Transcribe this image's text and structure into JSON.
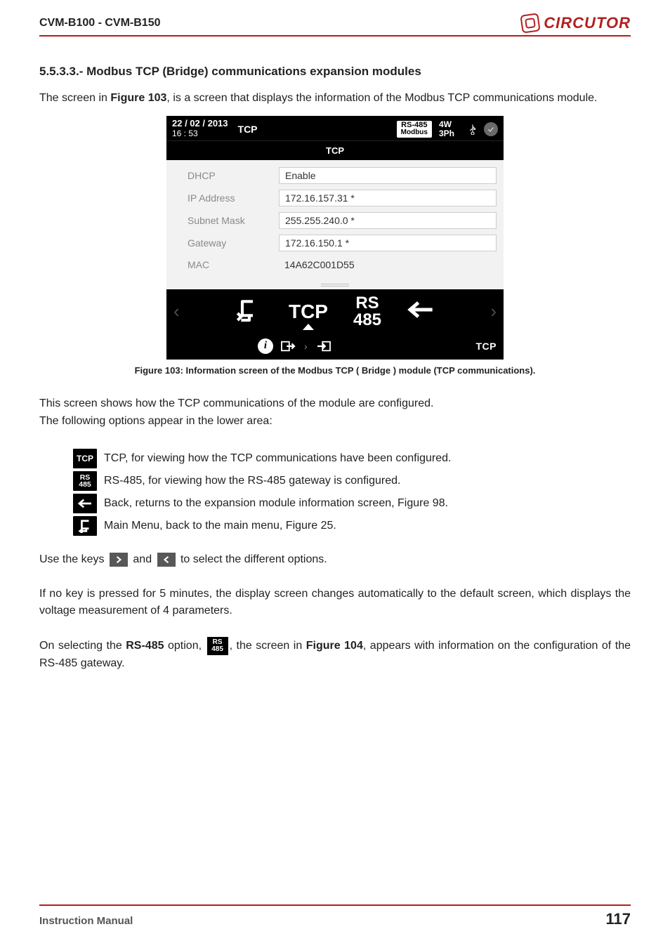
{
  "header": {
    "model": "CVM-B100 - CVM-B150",
    "brand": "CIRCUTOR"
  },
  "section": {
    "heading": "5.5.3.3.- Modbus TCP (Bridge) communications expansion modules",
    "intro_pre": "The screen in ",
    "intro_fig": "Figure 103",
    "intro_post": ", is a screen that displays the information of the Modbus TCP communications module."
  },
  "device": {
    "date": "22 / 02 / 2013",
    "time": "16 : 53",
    "top_tcp": "TCP",
    "rs485_chip_top": "RS-485",
    "rs485_chip_bottom": "Modbus",
    "mode_top": "4W",
    "mode_bottom": "3Ph",
    "title": "TCP",
    "rows": [
      {
        "label": "DHCP",
        "value": "Enable"
      },
      {
        "label": "IP Address",
        "value": "172.16.157.31 *"
      },
      {
        "label": "Subnet Mask",
        "value": "255.255.240.0 *"
      },
      {
        "label": "Gateway",
        "value": "172.16.150.1 *"
      },
      {
        "label": "MAC",
        "value": "14A62C001D55"
      }
    ],
    "nav": {
      "tcp": "TCP",
      "rs": "RS\n485"
    },
    "footer_tcp": "TCP"
  },
  "caption": "Figure 103: Information screen of the Modbus TCP ( Bridge ) module (TCP communications).",
  "after_caption_1": "This screen shows how the TCP communications of the module are configured.",
  "after_caption_2": "The following options appear in the lower area:",
  "options": {
    "tcp": "TCP, for viewing how the TCP communications have been configured.",
    "rs485": "RS-485, for viewing how the RS-485 gateway is configured.",
    "back_pre": "Back, returns to the expansion module information screen, ",
    "back_fig": "Figure 98",
    "back_post": ".",
    "menu_pre": "Main Menu, back to the main menu, ",
    "menu_fig": "Figure 25",
    "menu_post": "."
  },
  "keys_pre": "Use the keys ",
  "keys_mid": " and ",
  "keys_post": " to select the different options.",
  "timeout": "If no key is pressed for 5 minutes, the display screen changes automatically to the default screen, which displays the voltage measurement of 4 parameters.",
  "rs_select": {
    "pre": "On selecting the ",
    "bold1": "RS-485",
    "mid1": " option, ",
    "mid2": ", the screen in ",
    "fig": "Figure 104",
    "post": ", appears with information on the configuration of the RS-485 gateway."
  },
  "footer": {
    "manual": "Instruction Manual",
    "page": "117"
  },
  "icons": {
    "tcp_label": "TCP",
    "rs_top": "RS",
    "rs_bottom": "485"
  }
}
